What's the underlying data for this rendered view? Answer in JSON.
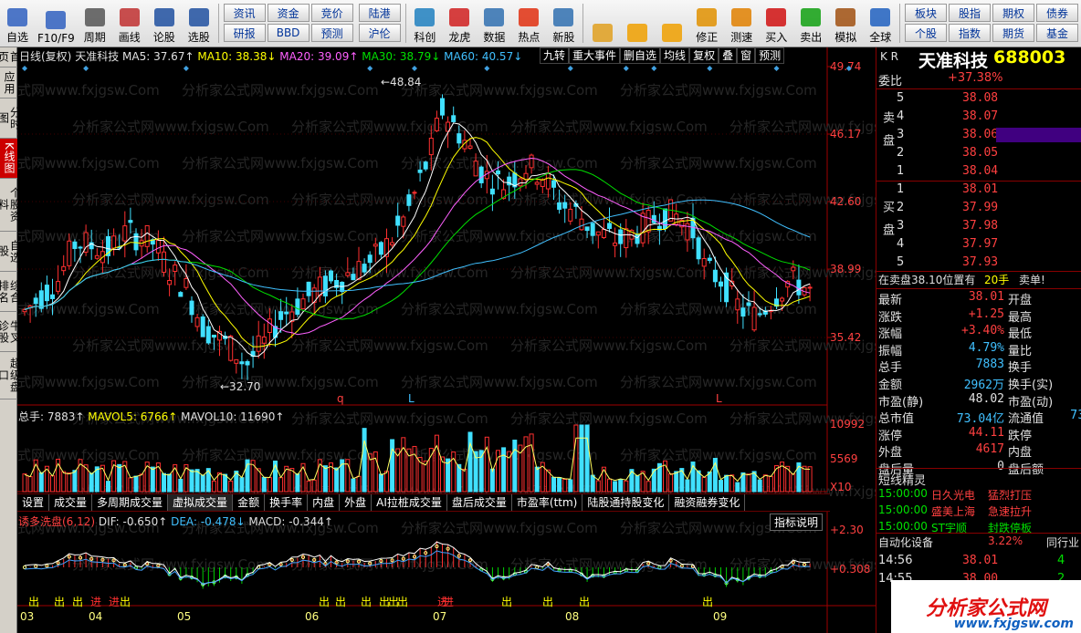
{
  "toolbar": {
    "tools": [
      {
        "label": "自选",
        "icon": "star-icon"
      },
      {
        "label": "F10/F9",
        "icon": "f10-icon"
      },
      {
        "label": "周期",
        "icon": "clock-icon"
      },
      {
        "label": "画线",
        "icon": "pencil-icon"
      },
      {
        "label": "论股",
        "icon": "discuss-icon"
      },
      {
        "label": "选股",
        "icon": "select-stock-icon"
      }
    ],
    "buttons_a": [
      "资讯",
      "资金",
      "竞价",
      "研报",
      "BBD",
      "预测"
    ],
    "buttons_b": [
      "陆港",
      "沪伦"
    ],
    "tools2": [
      {
        "label": "科创",
        "icon": "kechuang-icon"
      },
      {
        "label": "龙虎",
        "icon": "dragon-tiger-icon"
      },
      {
        "label": "数据",
        "icon": "data-icon"
      },
      {
        "label": "热点",
        "icon": "hot-icon"
      },
      {
        "label": "新股",
        "icon": "new-stock-icon"
      }
    ],
    "tools3": [
      {
        "label": "",
        "icon": "window-icon"
      },
      {
        "label": "",
        "icon": "back-arrow-icon"
      },
      {
        "label": "",
        "icon": "up-down-icon"
      },
      {
        "label": "修正",
        "icon": "fix-icon"
      },
      {
        "label": "测速",
        "icon": "speed-icon"
      },
      {
        "label": "买入",
        "icon": "buy-icon"
      },
      {
        "label": "卖出",
        "icon": "sell-icon"
      },
      {
        "label": "模拟",
        "icon": "hammer-icon"
      },
      {
        "label": "全球",
        "icon": "globe-icon"
      }
    ],
    "buttons_c": [
      "板块",
      "股指",
      "期权",
      "债券",
      "个股",
      "指数",
      "期货",
      "基金"
    ]
  },
  "left_tabs": [
    "首页",
    "应用",
    "分时图",
    "K线图",
    "个股资料",
    "自选股",
    "综合排名",
    "牛叉诊股",
    "超级盘口"
  ],
  "chart": {
    "legend": {
      "title": "日线(复权)",
      "name": "天准科技",
      "ma5": "MA5: 37.67↑",
      "ma10": "MA10: 38.38↓",
      "ma20": "MA20: 39.09↑",
      "ma30": "MA30: 38.79↓",
      "ma60": "MA60: 40.57↓"
    },
    "buttons": [
      "九转",
      "重大事件",
      "删自选",
      "均线",
      "复权",
      "叠",
      "窗",
      "预测"
    ],
    "y_labels": [
      "49.74",
      "46.17",
      "42.60",
      "38.99",
      "35.42"
    ],
    "high_mark": "48.84",
    "low_mark": "32.70",
    "watermark": "分析家公式网www.fxjgsw.Com",
    "signal_letters": [
      "q",
      "L",
      "L"
    ],
    "volume": {
      "legend_total": "总手: 7883↑",
      "mavol5": "MAVOL5: 6766↑",
      "mavol10": "MAVOL10: 11690↑",
      "y_labels": [
        "10992",
        "5569",
        "X10"
      ]
    },
    "sub_tabs": [
      "设置",
      "成交量",
      "多周期成交量",
      "虚拟成交量",
      "金额",
      "换手率",
      "内盘",
      "外盘",
      "AI拉桩成交量",
      "盘后成交量",
      "市盈率(ttm)",
      "陆股通持股变化",
      "融资融券变化"
    ],
    "macd": {
      "name": "诱多洗盘(6,12)",
      "dif": "DIF: -0.650↑",
      "dea": "DEA: -0.478↓",
      "macd": "MACD: -0.344↑",
      "button": "指标说明",
      "y_labels": [
        "+2.30",
        "+0.308"
      ]
    },
    "signals": [
      "出",
      "出",
      "出",
      "进",
      "进",
      "出",
      "出",
      "出",
      "出",
      "出",
      "出",
      "出",
      "进",
      "进",
      "出",
      "出",
      "出",
      "出"
    ],
    "months": [
      "03",
      "04",
      "05",
      "06",
      "07",
      "08",
      "09"
    ]
  },
  "right": {
    "code": "K R",
    "name": "天准科技",
    "code_num": "688003",
    "webi_label": "委比",
    "webi_value": "+37.38%",
    "sell_label": "卖盘",
    "buy_label": "买盘",
    "sells": [
      {
        "n": "5",
        "p": "38.08"
      },
      {
        "n": "4",
        "p": "38.07"
      },
      {
        "n": "3",
        "p": "38.06"
      },
      {
        "n": "2",
        "p": "38.05"
      },
      {
        "n": "1",
        "p": "38.04"
      }
    ],
    "buys": [
      {
        "n": "1",
        "p": "38.01"
      },
      {
        "n": "2",
        "p": "37.99"
      },
      {
        "n": "3",
        "p": "37.98"
      },
      {
        "n": "4",
        "p": "37.97"
      },
      {
        "n": "5",
        "p": "37.93"
      }
    ],
    "order_note": "在卖盘38.10位置有",
    "order_qty": "20手",
    "order_action": "卖单!",
    "stats": [
      {
        "l": "最新",
        "v": "38.01",
        "l2": "开盘"
      },
      {
        "l": "涨跌",
        "v": "+1.25",
        "l2": "最高"
      },
      {
        "l": "涨幅",
        "v": "+3.40%",
        "l2": "最低"
      },
      {
        "l": "振幅",
        "v": "4.79%",
        "l2": "量比"
      },
      {
        "l": "总手",
        "v": "7883",
        "l2": "换手"
      },
      {
        "l": "金额",
        "v": "2962万",
        "l2": "换手(实)"
      },
      {
        "l": "市盈(静)",
        "v": "48.02",
        "l2": "市盈(动)"
      },
      {
        "l": "总市值",
        "v": "73.04亿",
        "l2": "流通值",
        "v2": "73"
      },
      {
        "l": "涨停",
        "v": "44.11",
        "l2": "跌停"
      },
      {
        "l": "外盘",
        "v": "4617",
        "l2": "内盘"
      },
      {
        "l": "盘后量",
        "v": "0",
        "l2": "盘后额"
      }
    ],
    "short_title": "短线精灵",
    "short": [
      {
        "t": "15:00:00",
        "s": "日久光电",
        "e": "猛烈打压"
      },
      {
        "t": "15:00:00",
        "s": "盛美上海",
        "e": "急速拉升"
      },
      {
        "t": "15:00:00",
        "s": "ST宇顺",
        "e": "封跌停板"
      }
    ],
    "sector": "自动化设备",
    "sector_pct": "3.22%",
    "sector_btn": "同行业",
    "ticks": [
      {
        "t": "14:56",
        "p": "38.01",
        "v": "4"
      },
      {
        "t": "14:55",
        "p": "38.00",
        "v": "2"
      }
    ],
    "logo": "分析家公式网",
    "logo_url": "www.fxjgsw.com"
  }
}
